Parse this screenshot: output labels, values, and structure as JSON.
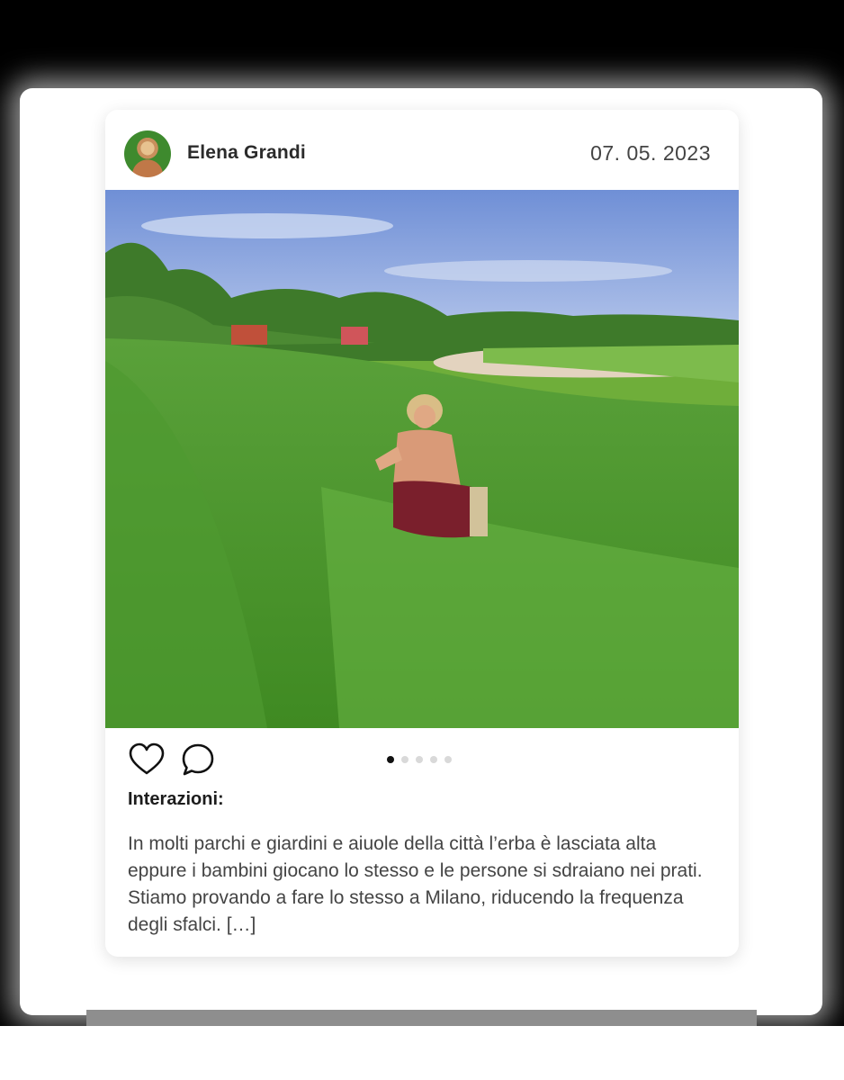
{
  "post": {
    "author": "Elena Grandi",
    "date": "07. 05. 2023",
    "image_description_icon": "photo",
    "carousel": {
      "total": 5,
      "active_index": 0
    },
    "actions": {
      "like_icon": "heart-icon",
      "comment_icon": "comment-icon"
    },
    "section_title": "Interazioni:",
    "caption": "In molti parchi e giardini e aiuole della città l’erba è lasciata alta eppure i bambini giocano lo stesso e le persone si sdraiano nei prati. Stiamo provando a fare lo stesso a Milano, riducendo la frequenza degli sfalci. […]"
  },
  "colors": {
    "card_bg": "#ffffff",
    "page_bg": "#000000",
    "active_dot": "#111111",
    "inactive_dot": "#d9d9d9"
  }
}
